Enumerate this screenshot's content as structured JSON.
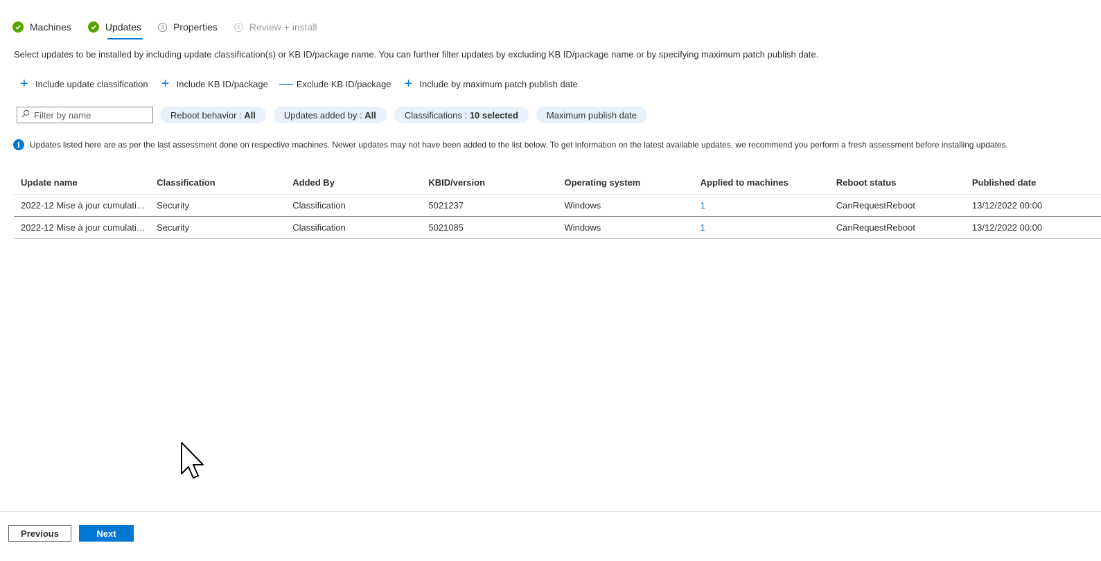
{
  "wizard": {
    "tabs": [
      {
        "label": "Machines",
        "state": "done"
      },
      {
        "label": "Updates",
        "state": "done"
      },
      {
        "label": "Properties",
        "number": "3"
      },
      {
        "label": "Review + install",
        "number": "4"
      }
    ]
  },
  "description": "Select updates to be installed by including update classification(s) or KB ID/package name. You can further filter updates by excluding KB ID/package name or by specifying maximum patch publish date.",
  "actions": {
    "include_classification": "Include update classification",
    "include_kb": "Include KB ID/package",
    "exclude_kb": "Exclude KB ID/package",
    "include_max_date": "Include by maximum patch publish date"
  },
  "filters": {
    "search_placeholder": "Filter by name",
    "reboot_label": "Reboot behavior : ",
    "reboot_value": "All",
    "added_by_label": "Updates added by : ",
    "added_by_value": "All",
    "classifications_label": "Classifications : ",
    "classifications_value": "10 selected",
    "max_publish_date": "Maximum publish date"
  },
  "info": {
    "icon": "info-icon",
    "text": "Updates listed here are as per the last assessment done on respective machines. Newer updates may not have been added to the list below. To get information on the latest available updates, we recommend you perform a fresh assessment before installing updates."
  },
  "table": {
    "headers": [
      "Update name",
      "Classification",
      "Added By",
      "KBID/version",
      "Operating system",
      "Applied to machines",
      "Reboot status",
      "Published date"
    ],
    "rows": [
      [
        "2022-12 Mise à jour cumulative…",
        "Security",
        "Classification",
        "5021237",
        "Windows",
        "1",
        "CanRequestReboot",
        "13/12/2022 00:00"
      ],
      [
        "2022-12 Mise à jour cumulative…",
        "Security",
        "Classification",
        "5021085",
        "Windows",
        "1",
        "CanRequestReboot",
        "13/12/2022 00:00"
      ]
    ]
  },
  "footer": {
    "previous": "Previous",
    "next": "Next"
  },
  "colors": {
    "accent": "#0078d4",
    "success": "#57a300",
    "pill_bg": "#e8f1fb"
  }
}
